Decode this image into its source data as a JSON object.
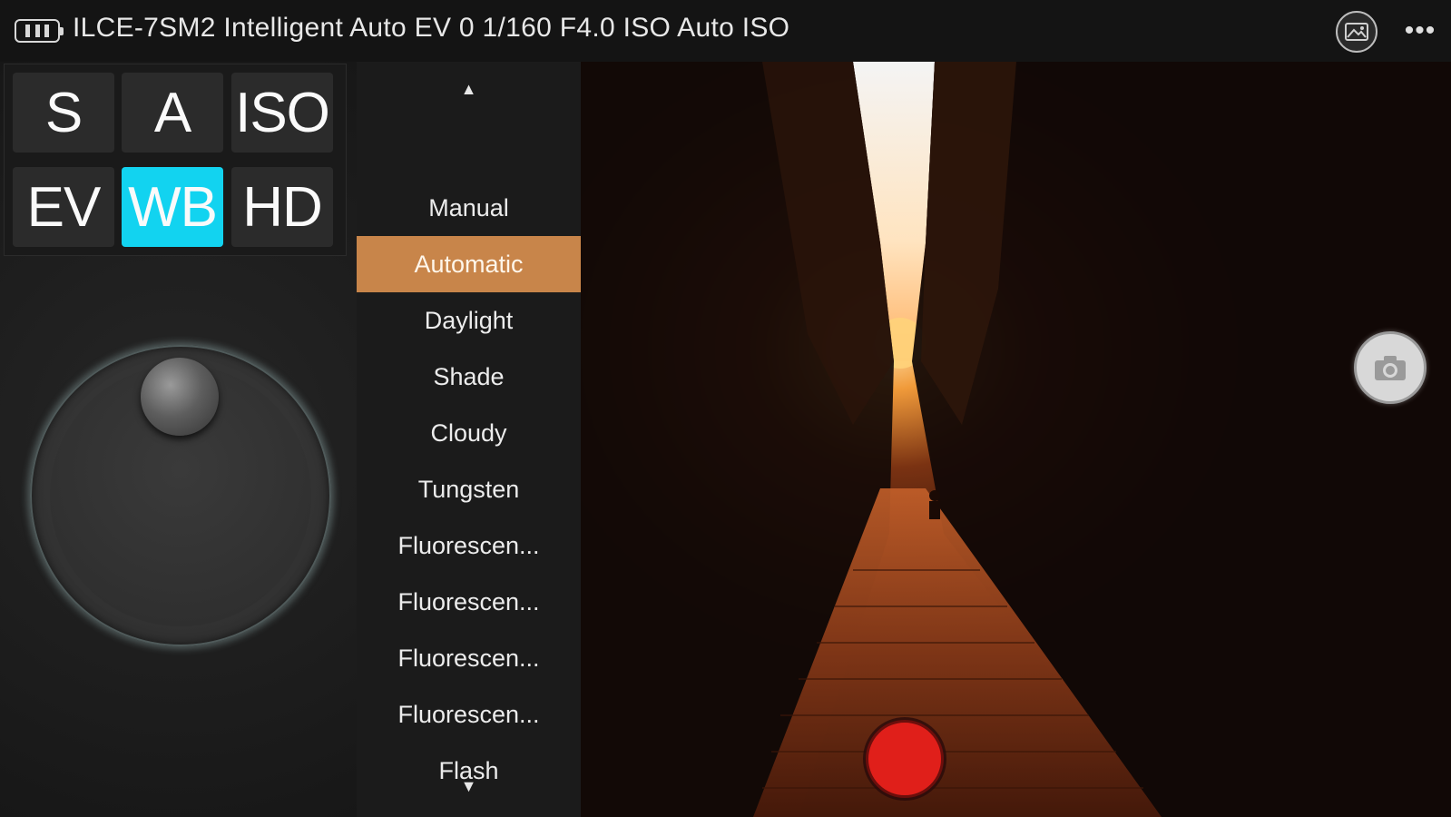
{
  "status_bar": {
    "text": "ILCE-7SM2 Intelligent Auto EV 0 1/160 F4.0 ISO Auto ISO",
    "battery_icon": "battery-icon",
    "gallery_icon": "gallery-icon",
    "more_label": "•••"
  },
  "mode_buttons": [
    {
      "label": "S"
    },
    {
      "label": "A"
    },
    {
      "label": "ISO"
    },
    {
      "label": "EV"
    },
    {
      "label": "WB",
      "active": true
    },
    {
      "label": "HD"
    }
  ],
  "wb_list": {
    "up_arrow": "▲",
    "down_arrow": "▼",
    "items": [
      "Manual",
      "Automatic",
      "Daylight",
      "Shade",
      "Cloudy",
      "Tungsten",
      "Fluorescen...",
      "Fluorescen...",
      "Fluorescen...",
      "Fluorescen...",
      "Flash"
    ],
    "selected": "Automatic"
  },
  "colors": {
    "active_mode": "#12d3f0",
    "selected_item": "#c8854a",
    "record": "#e01f1a"
  }
}
